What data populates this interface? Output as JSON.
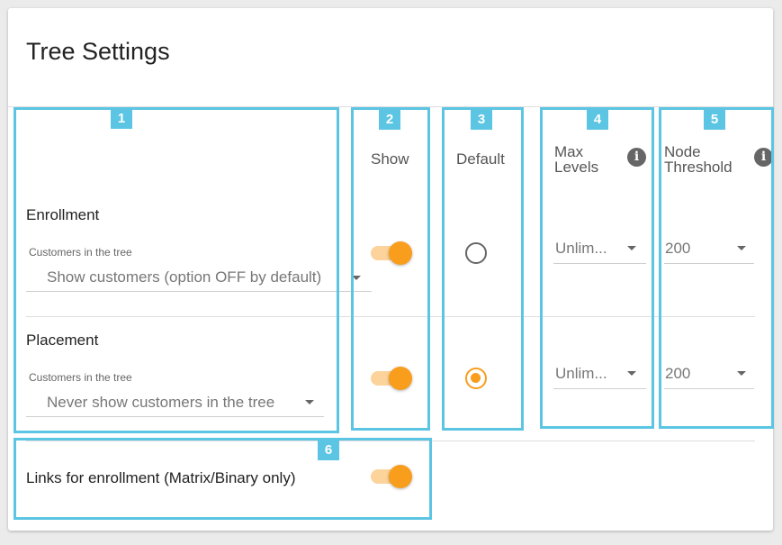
{
  "page": {
    "title": "Tree Settings"
  },
  "columns": {
    "show": "Show",
    "default": "Default",
    "max_levels": "Max Levels",
    "node_threshold": "Node Threshold",
    "max_levels_info_icon": "info-icon",
    "node_threshold_info_icon": "info-icon"
  },
  "rows": [
    {
      "label": "Enrollment",
      "field_label": "Customers in the tree",
      "select_value": "Show customers (option OFF by default)",
      "show": true,
      "default": false,
      "max_levels": "Unlim...",
      "node_threshold": "200"
    },
    {
      "label": "Placement",
      "field_label": "Customers in the tree",
      "select_value": "Never show customers in the tree",
      "show": true,
      "default": true,
      "max_levels": "Unlim...",
      "node_threshold": "200"
    }
  ],
  "links_row": {
    "label": "Links for enrollment (Matrix/Binary only)",
    "enabled": true
  },
  "annotations": [
    "1",
    "2",
    "3",
    "4",
    "5",
    "6"
  ],
  "colors": {
    "accent": "#f99d1c",
    "accent_light": "#fcd39a",
    "annotation": "#5bc5e3"
  }
}
